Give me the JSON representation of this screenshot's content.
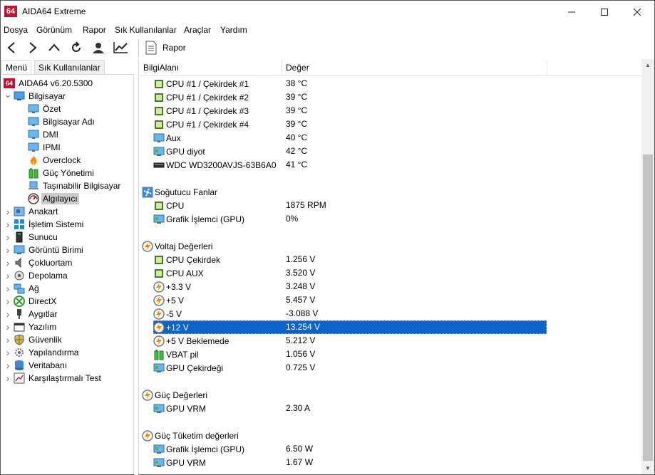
{
  "window": {
    "title": "AIDA64 Extreme",
    "logo_text": "64"
  },
  "menubar": [
    "Dosya",
    "Görünüm",
    "Rapor",
    "Sık Kullanılanlar",
    "Araçlar",
    "Yardım"
  ],
  "toolbar": {
    "report_label": "Rapor"
  },
  "left_tabs": {
    "menu": "Menü",
    "favorites": "Sık Kullanılanlar"
  },
  "tree": [
    {
      "label": "AIDA64 v6.20.5300",
      "icon": "aida64-logo-icon",
      "level": 0,
      "expander": ""
    },
    {
      "label": "Bilgisayar",
      "icon": "computer-icon",
      "level": 0,
      "expander": "open"
    },
    {
      "label": "Özet",
      "icon": "monitor-icon",
      "level": 1,
      "expander": ""
    },
    {
      "label": "Bilgisayar Adı",
      "icon": "monitor-icon",
      "level": 1,
      "expander": ""
    },
    {
      "label": "DMI",
      "icon": "monitor-icon",
      "level": 1,
      "expander": ""
    },
    {
      "label": "IPMI",
      "icon": "monitor-icon",
      "level": 1,
      "expander": ""
    },
    {
      "label": "Overclock",
      "icon": "flame-icon",
      "level": 1,
      "expander": ""
    },
    {
      "label": "Güç Yönetimi",
      "icon": "battery-icon",
      "level": 1,
      "expander": ""
    },
    {
      "label": "Taşınabilir Bilgisayar",
      "icon": "laptop-icon",
      "level": 1,
      "expander": ""
    },
    {
      "label": "Algılayıcı",
      "icon": "gauge-icon",
      "level": 1,
      "expander": "",
      "selected": true
    },
    {
      "label": "Anakart",
      "icon": "motherboard-icon",
      "level": 0,
      "expander": "closed"
    },
    {
      "label": "İşletim Sistemi",
      "icon": "windows-icon",
      "level": 0,
      "expander": "closed"
    },
    {
      "label": "Sunucu",
      "icon": "server-icon",
      "level": 0,
      "expander": "closed"
    },
    {
      "label": "Görüntü Birimi",
      "icon": "display-icon",
      "level": 0,
      "expander": "closed"
    },
    {
      "label": "Çokluortam",
      "icon": "speaker-icon",
      "level": 0,
      "expander": "closed"
    },
    {
      "label": "Depolama",
      "icon": "disk-icon",
      "level": 0,
      "expander": "closed"
    },
    {
      "label": "Ağ",
      "icon": "network-icon",
      "level": 0,
      "expander": "closed"
    },
    {
      "label": "DirectX",
      "icon": "xbox-icon",
      "level": 0,
      "expander": "closed"
    },
    {
      "label": "Aygıtlar",
      "icon": "device-icon",
      "level": 0,
      "expander": "closed"
    },
    {
      "label": "Yazılım",
      "icon": "software-icon",
      "level": 0,
      "expander": "closed"
    },
    {
      "label": "Güvenlik",
      "icon": "shield-icon",
      "level": 0,
      "expander": "closed"
    },
    {
      "label": "Yapılandırma",
      "icon": "gear-icon",
      "level": 0,
      "expander": "closed"
    },
    {
      "label": "Veritabanı",
      "icon": "database-icon",
      "level": 0,
      "expander": "closed"
    },
    {
      "label": "Karşılaştırmalı Test",
      "icon": "benchmark-icon",
      "level": 0,
      "expander": "closed"
    }
  ],
  "list": {
    "columns": [
      "BilgiAlanı",
      "Değer"
    ],
    "rows": [
      {
        "field": "CPU #1 / Çekirdek #1",
        "value": "38 °C",
        "icon": "chip-icon",
        "kind": "item"
      },
      {
        "field": "CPU #1 / Çekirdek #2",
        "value": "39 °C",
        "icon": "chip-icon",
        "kind": "item"
      },
      {
        "field": "CPU #1 / Çekirdek #3",
        "value": "39 °C",
        "icon": "chip-icon",
        "kind": "item"
      },
      {
        "field": "CPU #1 / Çekirdek #4",
        "value": "39 °C",
        "icon": "chip-icon",
        "kind": "item"
      },
      {
        "field": "Aux",
        "value": "40 °C",
        "icon": "monitor-icon",
        "kind": "item"
      },
      {
        "field": "GPU diyot",
        "value": "42 °C",
        "icon": "gpu-icon",
        "kind": "item"
      },
      {
        "field": "WDC WD3200AVJS-63B6A0",
        "value": "41 °C",
        "icon": "hdd-icon",
        "kind": "item"
      },
      {
        "field": "",
        "value": "",
        "icon": "",
        "kind": "blank"
      },
      {
        "field": "Soğutucu Fanlar",
        "value": "",
        "icon": "fan-icon",
        "kind": "group"
      },
      {
        "field": "CPU",
        "value": "1875 RPM",
        "icon": "chip-icon",
        "kind": "item"
      },
      {
        "field": "Grafik İşlemci (GPU)",
        "value": "0%",
        "icon": "gpu-icon",
        "kind": "item"
      },
      {
        "field": "",
        "value": "",
        "icon": "",
        "kind": "blank"
      },
      {
        "field": "Voltaj Değerleri",
        "value": "",
        "icon": "voltage-icon",
        "kind": "group"
      },
      {
        "field": "CPU Çekirdek",
        "value": "1.256 V",
        "icon": "chip-icon",
        "kind": "item"
      },
      {
        "field": "CPU AUX",
        "value": "3.520 V",
        "icon": "chip-icon",
        "kind": "item"
      },
      {
        "field": "+3.3 V",
        "value": "3.248 V",
        "icon": "voltage-icon",
        "kind": "item"
      },
      {
        "field": "+5 V",
        "value": "5.457 V",
        "icon": "voltage-icon",
        "kind": "item"
      },
      {
        "field": "-5 V",
        "value": "-3.088 V",
        "icon": "voltage-icon",
        "kind": "item"
      },
      {
        "field": "+12 V",
        "value": "13.254 V",
        "icon": "voltage-icon",
        "kind": "item",
        "selected": true
      },
      {
        "field": "+5 V Beklemede",
        "value": "5.212 V",
        "icon": "voltage-icon",
        "kind": "item"
      },
      {
        "field": "VBAT pil",
        "value": "1.056 V",
        "icon": "battery-icon",
        "kind": "item"
      },
      {
        "field": "GPU Çekirdeği",
        "value": "0.725 V",
        "icon": "gpu-icon",
        "kind": "item"
      },
      {
        "field": "",
        "value": "",
        "icon": "",
        "kind": "blank"
      },
      {
        "field": "Güç Değerleri",
        "value": "",
        "icon": "voltage-icon",
        "kind": "group"
      },
      {
        "field": "GPU VRM",
        "value": "2.30 A",
        "icon": "gpu-icon",
        "kind": "item"
      },
      {
        "field": "",
        "value": "",
        "icon": "",
        "kind": "blank"
      },
      {
        "field": "Güç Tüketim değerleri",
        "value": "",
        "icon": "voltage-icon",
        "kind": "group"
      },
      {
        "field": "Grafik İşlemci (GPU)",
        "value": "6.50 W",
        "icon": "gpu-icon",
        "kind": "item"
      },
      {
        "field": "GPU VRM",
        "value": "1.67 W",
        "icon": "gpu-icon",
        "kind": "item"
      }
    ]
  },
  "colors": {
    "selection": "#0a64cc",
    "logo_red": "#c8102e",
    "tree_selection": "#cccccc"
  }
}
